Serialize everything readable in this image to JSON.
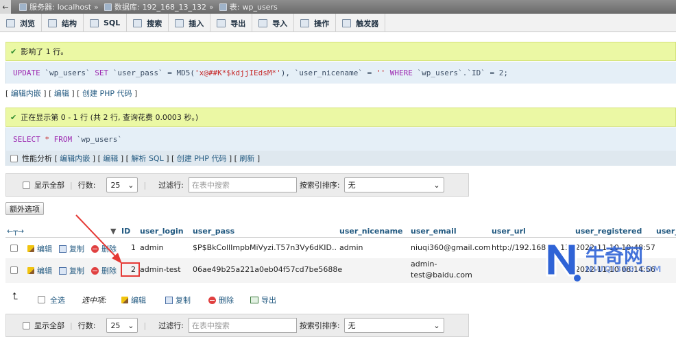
{
  "breadcrumb": {
    "back": "←",
    "server_label": "服务器:",
    "server": "localhost",
    "db_label": "数据库:",
    "db": "192_168_13_132",
    "table_label": "表:",
    "table": "wp_users",
    "sep": "»"
  },
  "tabs": [
    {
      "label": "浏览",
      "icon": "browse-icon"
    },
    {
      "label": "结构",
      "icon": "structure-icon"
    },
    {
      "label": "SQL",
      "icon": "sql-icon"
    },
    {
      "label": "搜索",
      "icon": "search-icon"
    },
    {
      "label": "插入",
      "icon": "insert-icon"
    },
    {
      "label": "导出",
      "icon": "export-icon"
    },
    {
      "label": "导入",
      "icon": "import-icon"
    },
    {
      "label": "操作",
      "icon": "operations-icon"
    },
    {
      "label": "触发器",
      "icon": "triggers-icon"
    }
  ],
  "update_msg": "影响了 1 行。",
  "update_sql": {
    "p1": "UPDATE",
    "p2": " `wp_users` ",
    "p3": "SET",
    "p4": " `user_pass` = MD5(",
    "p5": "'x@##K*$kdjjIEdsM*'",
    "p6": "), `user_nicename` = ",
    "p7": "''",
    "p8": " ",
    "p9": "WHERE",
    "p10": " `wp_users`.`ID` = 2;"
  },
  "links1": {
    "open": "[ ",
    "edit_inline": "编辑内嵌",
    "mid1": " ] [ ",
    "edit": "编辑",
    "mid2": " ] [ ",
    "create_php": "创建 PHP 代码",
    "close": " ]"
  },
  "select_msg": "正在显示第 0 - 1 行 (共 2 行, 查询花费 0.0003 秒。)",
  "select_sql": {
    "p1": "SELECT",
    "p2": " ",
    "p3": "*",
    "p4": " ",
    "p5": "FROM",
    "p6": " `wp_users`"
  },
  "links2": {
    "profiling": "性能分析",
    "open": " [ ",
    "edit_inline": "编辑内嵌",
    "mid1": " ] [ ",
    "edit": "编辑",
    "mid2": " ] [ ",
    "explain": "解析 SQL",
    "mid3": " ] [ ",
    "create_php": "创建 PHP 代码",
    "mid4": " ] [ ",
    "refresh": "刷新",
    "close": " ]"
  },
  "nav": {
    "show_all": "显示全部",
    "rows_label": "行数:",
    "rows_value": "25",
    "filter_label": "过滤行:",
    "filter_placeholder": "在表中搜索",
    "sort_label": "按索引排序:",
    "sort_value": "无"
  },
  "extra_options": "额外选项",
  "table": {
    "columns": [
      "ID",
      "user_login",
      "user_pass",
      "user_nicename",
      "user_email",
      "user_url",
      "user_registered",
      "user_"
    ],
    "row_actions": {
      "edit": "编辑",
      "copy": "复制",
      "delete": "删除"
    },
    "rows": [
      {
        "id": "1",
        "login": "admin",
        "pass": "$P$BkCollImpbMiVyzi.T57n3Vy6dKID..",
        "nicename": "admin",
        "email": "niuqi360@gmail.com",
        "url": "http://192.168.13.132",
        "registered": "2022-11-10 10:48:57"
      },
      {
        "id": "2",
        "login": "admin-test",
        "pass": "06ae49b25a221a0eb04f57cd7be5688e",
        "nicename": "",
        "email_l1": "admin-",
        "email_l2": "test@baidu.com",
        "url": "",
        "registered": "2022-11-10 08:14:56"
      }
    ]
  },
  "bulk": {
    "check_all": "全选",
    "with_selected": "选中项:",
    "edit": "编辑",
    "copy": "复制",
    "delete": "删除",
    "export": "导出"
  },
  "watermark": {
    "name": "牛奇网",
    "url": "NIUQI360.COM"
  },
  "colors": {
    "success_bg": "#ebf8a4",
    "sql_bg": "#e5eff7",
    "link": "#235a81",
    "highlight": "#e53935"
  }
}
